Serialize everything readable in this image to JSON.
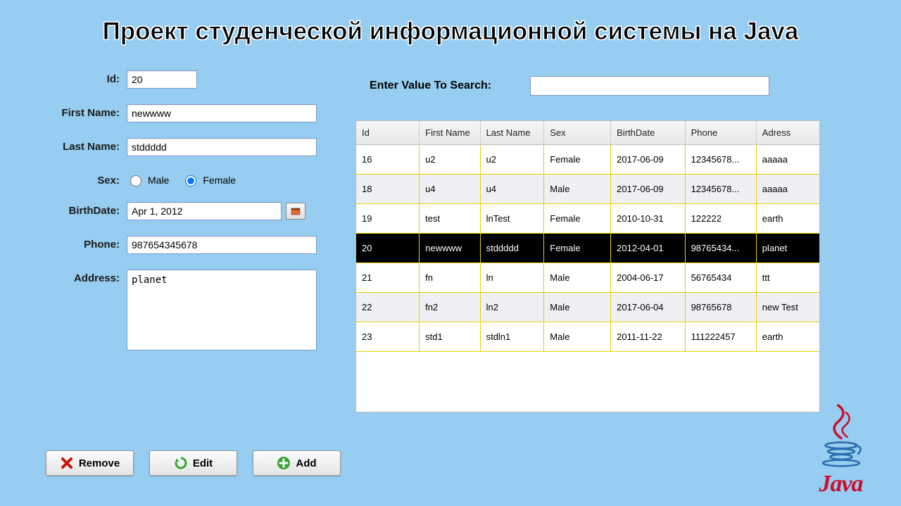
{
  "title": "Проект студенческой информационной системы на Java",
  "form": {
    "id_label": "Id:",
    "id_value": "20",
    "first_name_label": "First Name:",
    "first_name_value": "newwww",
    "last_name_label": "Last Name:",
    "last_name_value": "stddddd",
    "sex_label": "Sex:",
    "sex_male": "Male",
    "sex_female": "Female",
    "sex_selected": "Female",
    "birthdate_label": "BirthDate:",
    "birthdate_value": "Apr 1, 2012",
    "phone_label": "Phone:",
    "phone_value": "987654345678",
    "address_label": "Address:",
    "address_value": "planet"
  },
  "buttons": {
    "remove": "Remove",
    "edit": "Edit",
    "add": "Add"
  },
  "search": {
    "label": "Enter Value To Search:",
    "value": ""
  },
  "table": {
    "headers": [
      "Id",
      "First Name",
      "Last Name",
      "Sex",
      "BirthDate",
      "Phone",
      "Adress"
    ],
    "selected_id": "20",
    "rows": [
      {
        "id": "16",
        "fn": "u2",
        "ln": "u2",
        "sex": "Female",
        "bd": "2017-06-09",
        "ph": "12345678...",
        "ad": "aaaaa"
      },
      {
        "id": "18",
        "fn": "u4",
        "ln": "u4",
        "sex": "Male",
        "bd": "2017-06-09",
        "ph": "12345678...",
        "ad": "aaaaa"
      },
      {
        "id": "19",
        "fn": "test",
        "ln": "lnTest",
        "sex": "Female",
        "bd": "2010-10-31",
        "ph": "122222",
        "ad": "earth"
      },
      {
        "id": "20",
        "fn": "newwww",
        "ln": "stddddd",
        "sex": "Female",
        "bd": "2012-04-01",
        "ph": "98765434...",
        "ad": "planet"
      },
      {
        "id": "21",
        "fn": "fn",
        "ln": "ln",
        "sex": "Male",
        "bd": "2004-06-17",
        "ph": "56765434",
        "ad": "ttt"
      },
      {
        "id": "22",
        "fn": "fn2",
        "ln": "ln2",
        "sex": "Male",
        "bd": "2017-06-04",
        "ph": "98765678",
        "ad": "new Test"
      },
      {
        "id": "23",
        "fn": "std1",
        "ln": "stdln1",
        "sex": "Male",
        "bd": "2011-11-22",
        "ph": "111222457",
        "ad": "earth"
      }
    ]
  },
  "logo": "Java",
  "colors": {
    "remove": "#c21807",
    "edit": "#3aa335",
    "add": "#3aa335"
  }
}
